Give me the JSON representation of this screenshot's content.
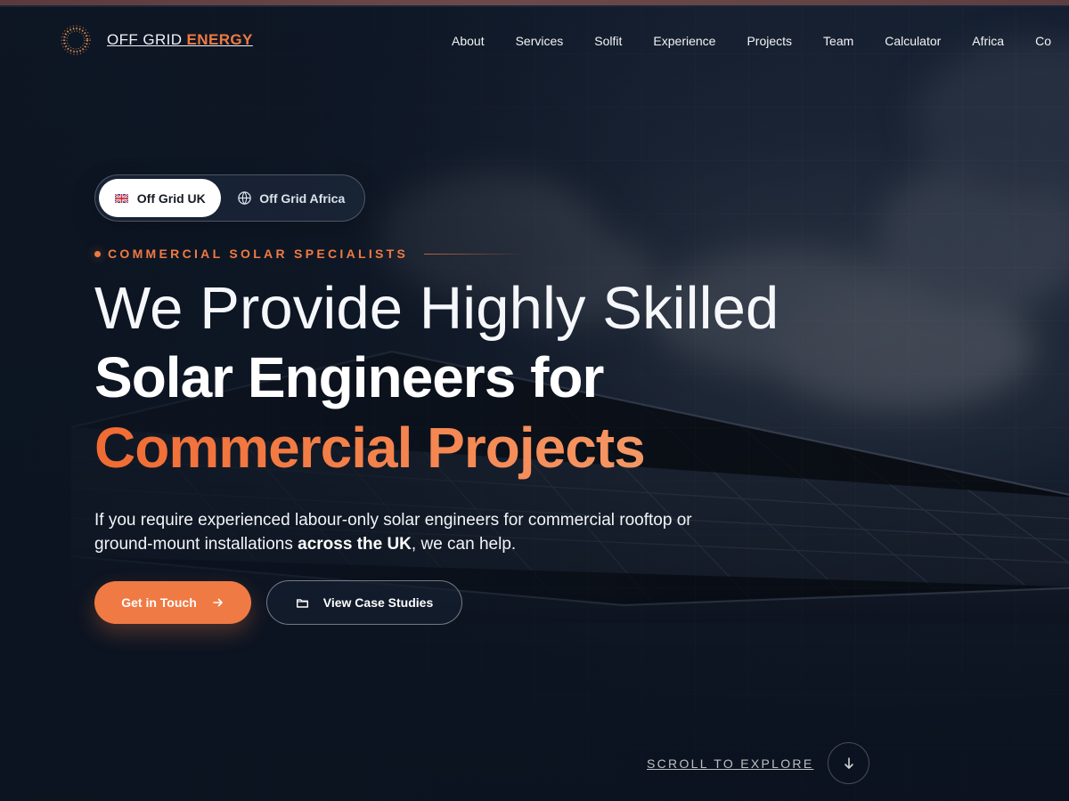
{
  "brand": {
    "prefix": "OFF GRID ",
    "suffix": "ENERGY",
    "logo_icon": "sun-ring-icon"
  },
  "nav": {
    "items": [
      {
        "label": "About"
      },
      {
        "label": "Services"
      },
      {
        "label": "Solfit"
      },
      {
        "label": "Experience"
      },
      {
        "label": "Projects"
      },
      {
        "label": "Team"
      },
      {
        "label": "Calculator"
      },
      {
        "label": "Africa"
      },
      {
        "label": "Co"
      }
    ]
  },
  "region_toggle": {
    "active": {
      "label": "Off Grid UK",
      "icon": "uk-flag-icon"
    },
    "inactive": {
      "label": "Off Grid Africa",
      "icon": "globe-icon"
    }
  },
  "hero": {
    "eyebrow": "COMMERCIAL SOLAR SPECIALISTS",
    "headline_light": "We Provide Highly Skilled",
    "headline_bold": "Solar Engineers for",
    "headline_accent": "Commercial Projects",
    "intro_before": "If you require experienced labour-only solar engineers for commercial rooftop or ground-mount installations ",
    "intro_strong": "across the UK",
    "intro_after": ", we can help."
  },
  "actions": {
    "primary": {
      "label": "Get in Touch",
      "icon": "arrow-right-icon"
    },
    "secondary": {
      "label": "View Case Studies",
      "icon": "folder-icon"
    }
  },
  "scroll": {
    "label": "SCROLL TO EXPLORE",
    "icon": "arrow-down-icon"
  },
  "colors": {
    "accent": "#f07a43",
    "background": "#111a2b",
    "text": "#ffffff",
    "muted_text": "#dbe2eb"
  }
}
